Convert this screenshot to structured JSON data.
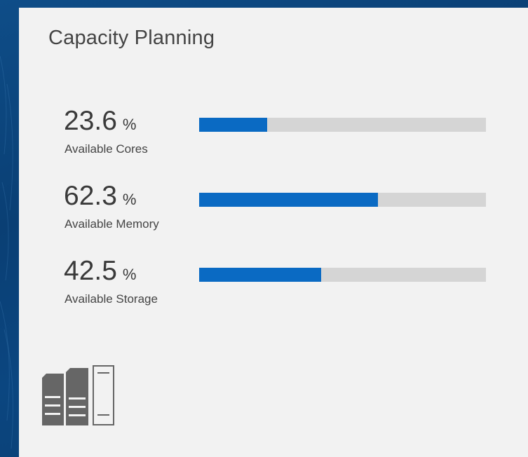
{
  "tile": {
    "title": "Capacity Planning",
    "icon": "server-rack-icon"
  },
  "metrics": [
    {
      "value": "23.6",
      "unit": "%",
      "label": "Available Cores",
      "fraction": 0.236
    },
    {
      "value": "62.3",
      "unit": "%",
      "label": "Available Memory",
      "fraction": 0.623
    },
    {
      "value": "42.5",
      "unit": "%",
      "label": "Available Storage",
      "fraction": 0.425
    }
  ],
  "colors": {
    "bar_fill": "#0a6ac3",
    "bar_track": "#d5d5d5",
    "tile_background": "#f2f2f2",
    "page_background": "#0b4680"
  }
}
